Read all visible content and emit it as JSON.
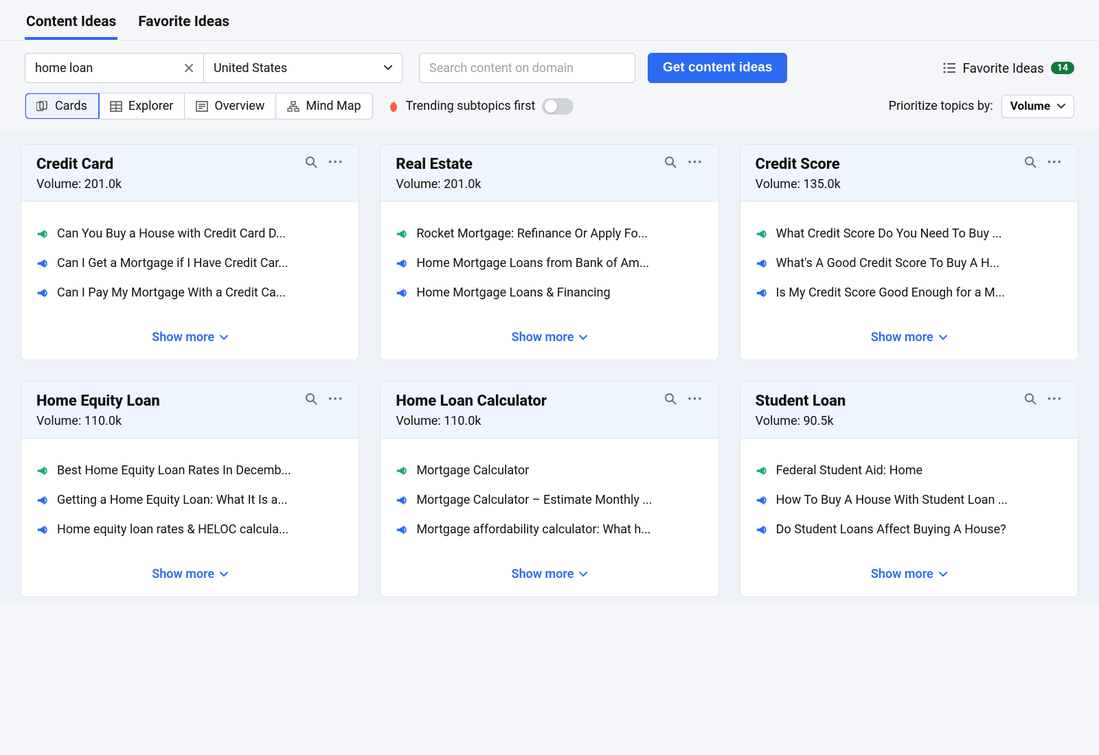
{
  "tabs": [
    {
      "label": "Content Ideas",
      "active": true
    },
    {
      "label": "Favorite Ideas",
      "active": false
    }
  ],
  "search": {
    "keyword_value": "home loan",
    "country_value": "United States",
    "domain_placeholder": "Search content on domain",
    "submit_label": "Get content ideas"
  },
  "favorites": {
    "label": "Favorite Ideas",
    "count": "14"
  },
  "views": [
    {
      "label": "Cards",
      "active": true
    },
    {
      "label": "Explorer",
      "active": false
    },
    {
      "label": "Overview",
      "active": false
    },
    {
      "label": "Mind Map",
      "active": false
    }
  ],
  "trending": {
    "label": "Trending subtopics first",
    "on": false
  },
  "prioritize": {
    "label": "Prioritize topics by:",
    "value": "Volume"
  },
  "show_more_label": "Show more",
  "volume_label_prefix": "Volume: ",
  "cards": [
    {
      "title": "Credit Card",
      "volume": "201.0k",
      "items": [
        {
          "color": "green",
          "text": "Can You Buy a House with Credit Card D..."
        },
        {
          "color": "blue",
          "text": "Can I Get a Mortgage if I Have Credit Car..."
        },
        {
          "color": "blue",
          "text": "Can I Pay My Mortgage With a Credit Ca..."
        }
      ]
    },
    {
      "title": "Real Estate",
      "volume": "201.0k",
      "items": [
        {
          "color": "green",
          "text": "Rocket Mortgage: Refinance Or Apply Fo..."
        },
        {
          "color": "blue",
          "text": "Home Mortgage Loans from Bank of Am..."
        },
        {
          "color": "blue",
          "text": "Home Mortgage Loans & Financing"
        }
      ]
    },
    {
      "title": "Credit Score",
      "volume": "135.0k",
      "items": [
        {
          "color": "green",
          "text": "What Credit Score Do You Need To Buy ..."
        },
        {
          "color": "blue",
          "text": "What's A Good Credit Score To Buy A H..."
        },
        {
          "color": "blue",
          "text": "Is My Credit Score Good Enough for a M..."
        }
      ]
    },
    {
      "title": "Home Equity Loan",
      "volume": "110.0k",
      "items": [
        {
          "color": "green",
          "text": "Best Home Equity Loan Rates In Decemb..."
        },
        {
          "color": "blue",
          "text": "Getting a Home Equity Loan: What It Is a..."
        },
        {
          "color": "blue",
          "text": "Home equity loan rates & HELOC calcula..."
        }
      ]
    },
    {
      "title": "Home Loan Calculator",
      "volume": "110.0k",
      "items": [
        {
          "color": "green",
          "text": "Mortgage Calculator"
        },
        {
          "color": "blue",
          "text": "Mortgage Calculator – Estimate Monthly ..."
        },
        {
          "color": "blue",
          "text": "Mortgage affordability calculator: What h..."
        }
      ]
    },
    {
      "title": "Student Loan",
      "volume": "90.5k",
      "items": [
        {
          "color": "green",
          "text": "Federal Student Aid: Home"
        },
        {
          "color": "blue",
          "text": "How To Buy A House With Student Loan ..."
        },
        {
          "color": "blue",
          "text": "Do Student Loans Affect Buying A House?"
        }
      ]
    }
  ]
}
